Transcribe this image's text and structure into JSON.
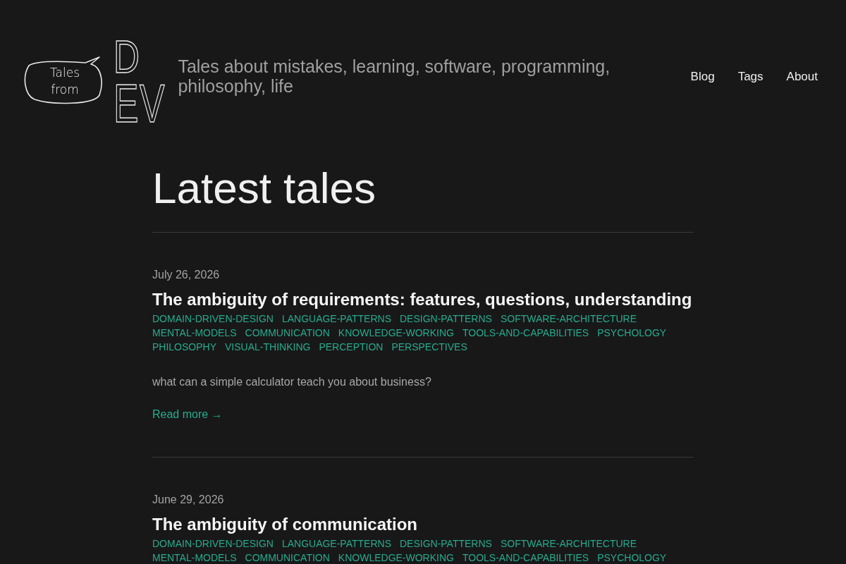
{
  "header": {
    "logo": {
      "bubble_text": "Tales from",
      "letters": [
        "D",
        "E",
        "V"
      ]
    },
    "tagline": "Tales about mistakes, learning, software, programming, philosophy, life",
    "nav": [
      "Blog",
      "Tags",
      "About"
    ]
  },
  "heading": "Latest tales",
  "posts": [
    {
      "date": "July 26, 2026",
      "title": "The ambiguity of requirements: features, questions, understanding",
      "tags": [
        "DOMAIN-DRIVEN-DESIGN",
        "LANGUAGE-PATTERNS",
        "DESIGN-PATTERNS",
        "SOFTWARE-ARCHITECTURE",
        "MENTAL-MODELS",
        "COMMUNICATION",
        "KNOWLEDGE-WORKING",
        "TOOLS-AND-CAPABILITIES",
        "PSYCHOLOGY",
        "PHILOSOPHY",
        "VISUAL-THINKING",
        "PERCEPTION",
        "PERSPECTIVES"
      ],
      "summary": "what can a simple calculator teach you about business?",
      "read_more": "Read more →"
    },
    {
      "date": "June 29, 2026",
      "title": "The ambiguity of communication",
      "tags": [
        "DOMAIN-DRIVEN-DESIGN",
        "LANGUAGE-PATTERNS",
        "DESIGN-PATTERNS",
        "SOFTWARE-ARCHITECTURE",
        "MENTAL-MODELS",
        "COMMUNICATION",
        "KNOWLEDGE-WORKING",
        "TOOLS-AND-CAPABILITIES",
        "PSYCHOLOGY"
      ]
    }
  ]
}
